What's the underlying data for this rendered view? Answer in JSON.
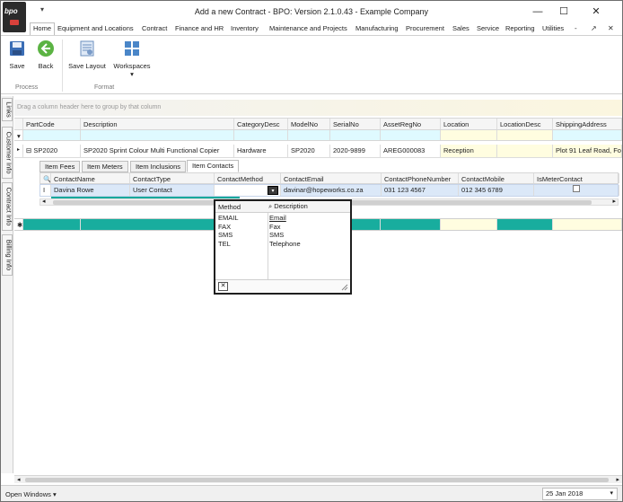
{
  "window": {
    "title": "Add a new Contract - BPO: Version 2.1.0.43 - Example Company",
    "logo_text": "bpo",
    "quick_access": "▾",
    "minimize": "—",
    "maximize": "☐",
    "close": "✕"
  },
  "menu": {
    "tabs": [
      "Home",
      "Equipment and Locations",
      "Contract",
      "Finance and HR",
      "Inventory",
      "Maintenance and Projects",
      "Manufacturing",
      "Procurement",
      "Sales",
      "Service",
      "Reporting",
      "Utilities"
    ],
    "right_icons": [
      "-",
      "↗",
      "✕"
    ]
  },
  "ribbon": {
    "save": "Save",
    "back": "Back",
    "save_layout": "Save Layout",
    "workspaces": "Workspaces",
    "group_process": "Process",
    "group_format": "Format"
  },
  "side_tabs": [
    "Links",
    "Customer Info",
    "Contract Info",
    "Billing Info"
  ],
  "grid": {
    "group_hint": "Drag a column header here to group by that column",
    "columns": [
      "PartCode",
      "Description",
      "CategoryDesc",
      "ModelNo",
      "SerialNo",
      "AssetRegNo",
      "Location",
      "LocationDesc",
      "ShippingAddress"
    ],
    "row": {
      "expand": "⊟",
      "partcode": "SP2020",
      "description": "SP2020 Sprint Colour Multi Functional Copier",
      "category": "Hardware",
      "model": "SP2020",
      "serial": "2020-9899",
      "asset": "AREG000083",
      "location": "Reception",
      "location_desc": "",
      "shipping": "Plot 91 Leaf Road, Fo"
    }
  },
  "detail": {
    "tabs": [
      "Item Fees",
      "Item Meters",
      "Item Inclusions",
      "Item Contacts"
    ],
    "active_tab": "Item Contacts",
    "columns": [
      "ContactName",
      "ContactType",
      "ContactMethod",
      "ContactEmail",
      "ContactPhoneNumber",
      "ContactMobile",
      "IsMeterContact"
    ],
    "row": {
      "name": "Davina Rowe",
      "type": "User Contact",
      "method": "",
      "email": "davinar@hopeworks.co.za",
      "phone": "031 123 4567",
      "mobile": "012 345 6789"
    }
  },
  "popup": {
    "col_method": "Method",
    "col_description": "Description",
    "items": [
      {
        "method": "EMAIL",
        "description": "Email"
      },
      {
        "method": "FAX",
        "description": "Fax"
      },
      {
        "method": "SMS",
        "description": "SMS"
      },
      {
        "method": "TEL",
        "description": "Telephone"
      }
    ],
    "close_label": "✕"
  },
  "status": {
    "open_windows": "Open Windows ▾",
    "date": "25 Jan 2018"
  }
}
